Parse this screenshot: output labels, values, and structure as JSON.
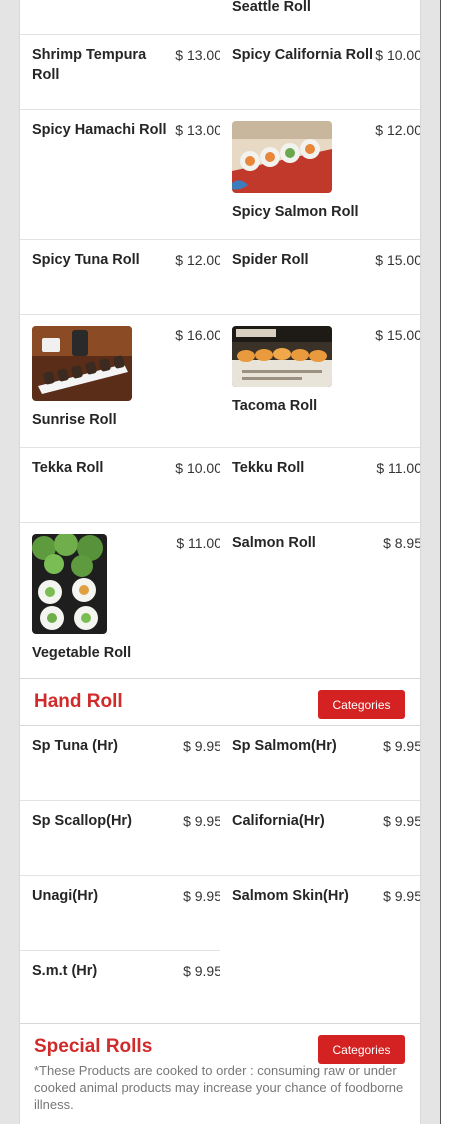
{
  "sushi_rolls": {
    "partial_item": {
      "name": "Seattle Roll"
    },
    "items": [
      {
        "name": "Shrimp Tempura Roll",
        "price": "$ 13.00"
      },
      {
        "name": "Spicy California Roll",
        "price": "$ 10.00"
      },
      {
        "name": "Spicy Hamachi Roll",
        "price": "$ 13.00"
      },
      {
        "name": "Spicy Salmon Roll",
        "price": "$ 12.00"
      },
      {
        "name": "Spicy Tuna Roll",
        "price": "$ 12.00"
      },
      {
        "name": "Spider Roll",
        "price": "$ 15.00"
      },
      {
        "name": "Sunrise Roll",
        "price": "$ 16.00"
      },
      {
        "name": "Tacoma Roll",
        "price": "$ 15.00"
      },
      {
        "name": "Tekka Roll",
        "price": "$ 10.00"
      },
      {
        "name": "Tekku Roll",
        "price": "$ 11.00"
      },
      {
        "name": "Vegetable Roll",
        "price": "$ 11.00"
      },
      {
        "name": "Salmon Roll",
        "price": "$ 8.95"
      }
    ]
  },
  "hand_roll": {
    "title": "Hand Roll",
    "categories_label": "Categories",
    "items": [
      {
        "name": "Sp Tuna (Hr)",
        "price": "$ 9.95"
      },
      {
        "name": "Sp Salmom(Hr)",
        "price": "$ 9.95"
      },
      {
        "name": "Sp Scallop(Hr)",
        "price": "$ 9.95"
      },
      {
        "name": "California(Hr)",
        "price": "$ 9.95"
      },
      {
        "name": "Unagi(Hr)",
        "price": "$ 9.95"
      },
      {
        "name": "Salmom Skin(Hr)",
        "price": "$ 9.95"
      },
      {
        "name": "S.m.t (Hr)",
        "price": "$ 9.95"
      }
    ]
  },
  "special_rolls": {
    "title": "Special Rolls",
    "categories_label": "Categories",
    "note": "*These Products are cooked to order : consuming raw or under cooked animal products may increase your chance of foodborne illness."
  }
}
